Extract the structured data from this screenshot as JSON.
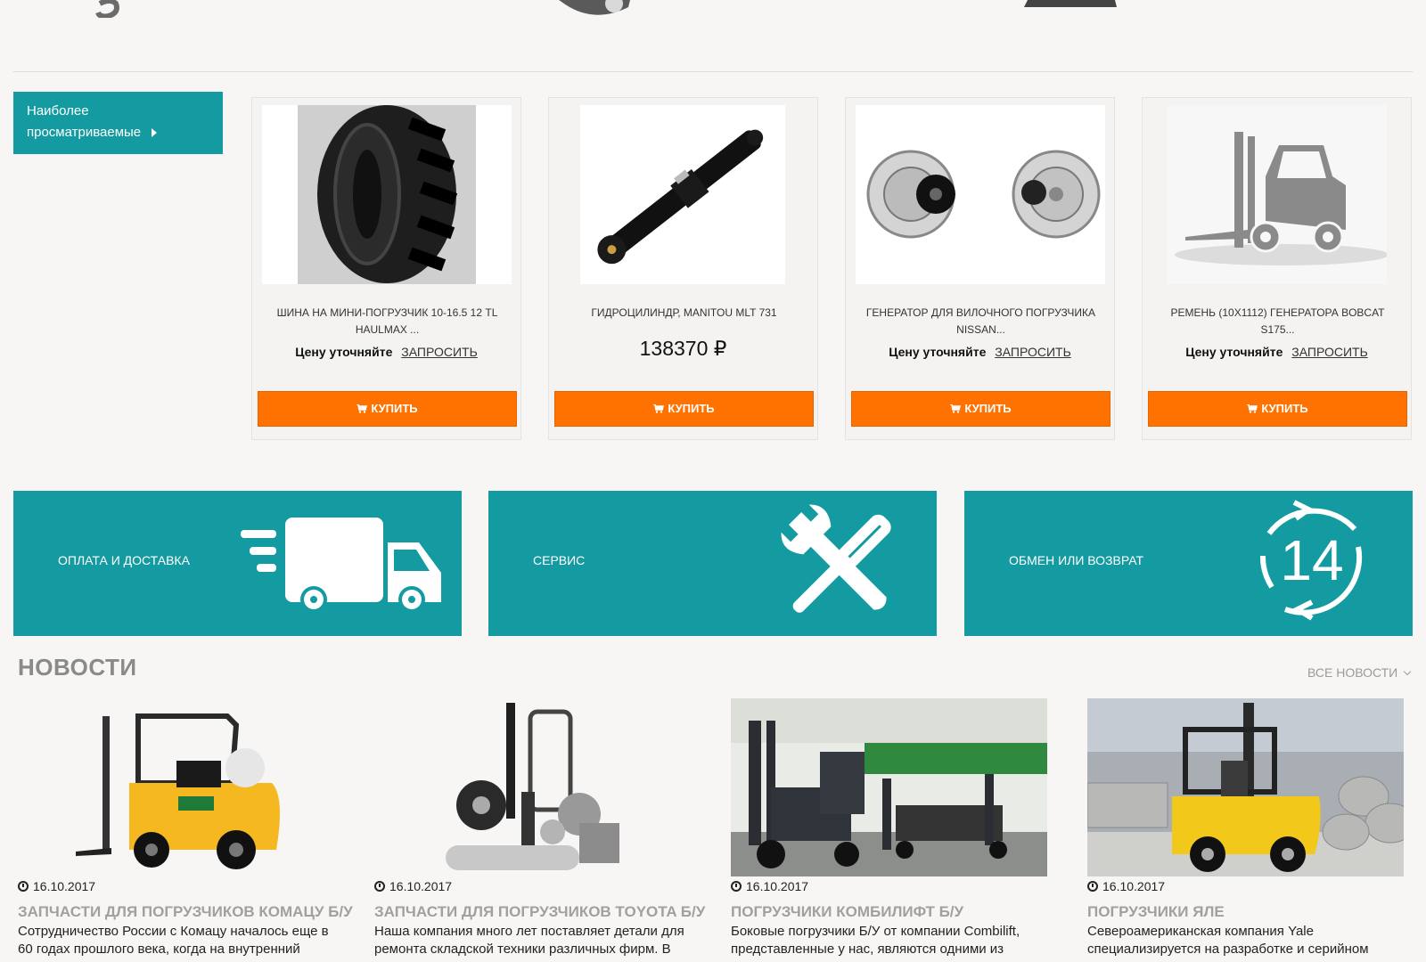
{
  "colors": {
    "teal": "#149ba1",
    "orange": "#ff7200",
    "background": "#f7f6f4"
  },
  "sidebar": {
    "label_line1": "Наиболее",
    "label_line2": "просматриваемые"
  },
  "products": [
    {
      "title": "ШИНА НА МИНИ-ПОГРУЗЧИК 10-16.5 12 TL HAULMAX ...",
      "price_text": "Цену уточняйте",
      "request_label": "ЗАПРОСИТЬ",
      "buy_label": "КУПИТЬ",
      "image": "tire"
    },
    {
      "title": "ГИДРОЦИЛИНДР, MANITOU MLT 731",
      "price": "138370 ₽",
      "buy_label": "КУПИТЬ",
      "image": "hydraulic-cylinder"
    },
    {
      "title": "ГЕНЕРАТОР ДЛЯ ВИЛОЧНОГО ПОГРУЗЧИКА NISSAN...",
      "price_text": "Цену уточняйте",
      "request_label": "ЗАПРОСИТЬ",
      "buy_label": "КУПИТЬ",
      "image": "alternator"
    },
    {
      "title": "РЕМЕНЬ (10X1112) ГЕНЕРАТОРА BOBCAT S175...",
      "price_text": "Цену уточняйте",
      "request_label": "ЗАПРОСИТЬ",
      "buy_label": "КУПИТЬ",
      "image": "forklift-placeholder"
    }
  ],
  "services": [
    {
      "label": "ОПЛАТА И ДОСТАВКА",
      "icon": "truck-icon"
    },
    {
      "label": "СЕРВИС",
      "icon": "tools-icon"
    },
    {
      "label": "ОБМЕН ИЛИ ВОЗВРАТ",
      "icon": "return-14-icon",
      "icon_text": "14"
    }
  ],
  "news": {
    "heading": "НОВОСТИ",
    "all_link": "ВСЕ НОВОСТИ",
    "items": [
      {
        "date": "16.10.2017",
        "title": "ЗАПЧАСТИ ДЛЯ ПОГРУЗЧИКОВ КОМАЦУ Б/У",
        "text": "Сотрудничество России с Комацу началось еще в 60 годах прошлого века, когда на внутренний"
      },
      {
        "date": "16.10.2017",
        "title": "ЗАПЧАСТИ ДЛЯ ПОГРУЗЧИКОВ TOYOTA Б/У",
        "text": "Наша компания много лет поставляет детали для ремонта складской техники различных фирм. В"
      },
      {
        "date": "16.10.2017",
        "title": "ПОГРУЗЧИКИ КОМБИЛИФТ Б/У",
        "text": "Боковые погрузчики Б/У от компании Combilift, представленные у нас, являются одними из"
      },
      {
        "date": "16.10.2017",
        "title": "ПОГРУЗЧИКИ ЯЛЕ",
        "text": "Североамериканская компания Yale специализируется на разработке и серийном"
      }
    ]
  }
}
